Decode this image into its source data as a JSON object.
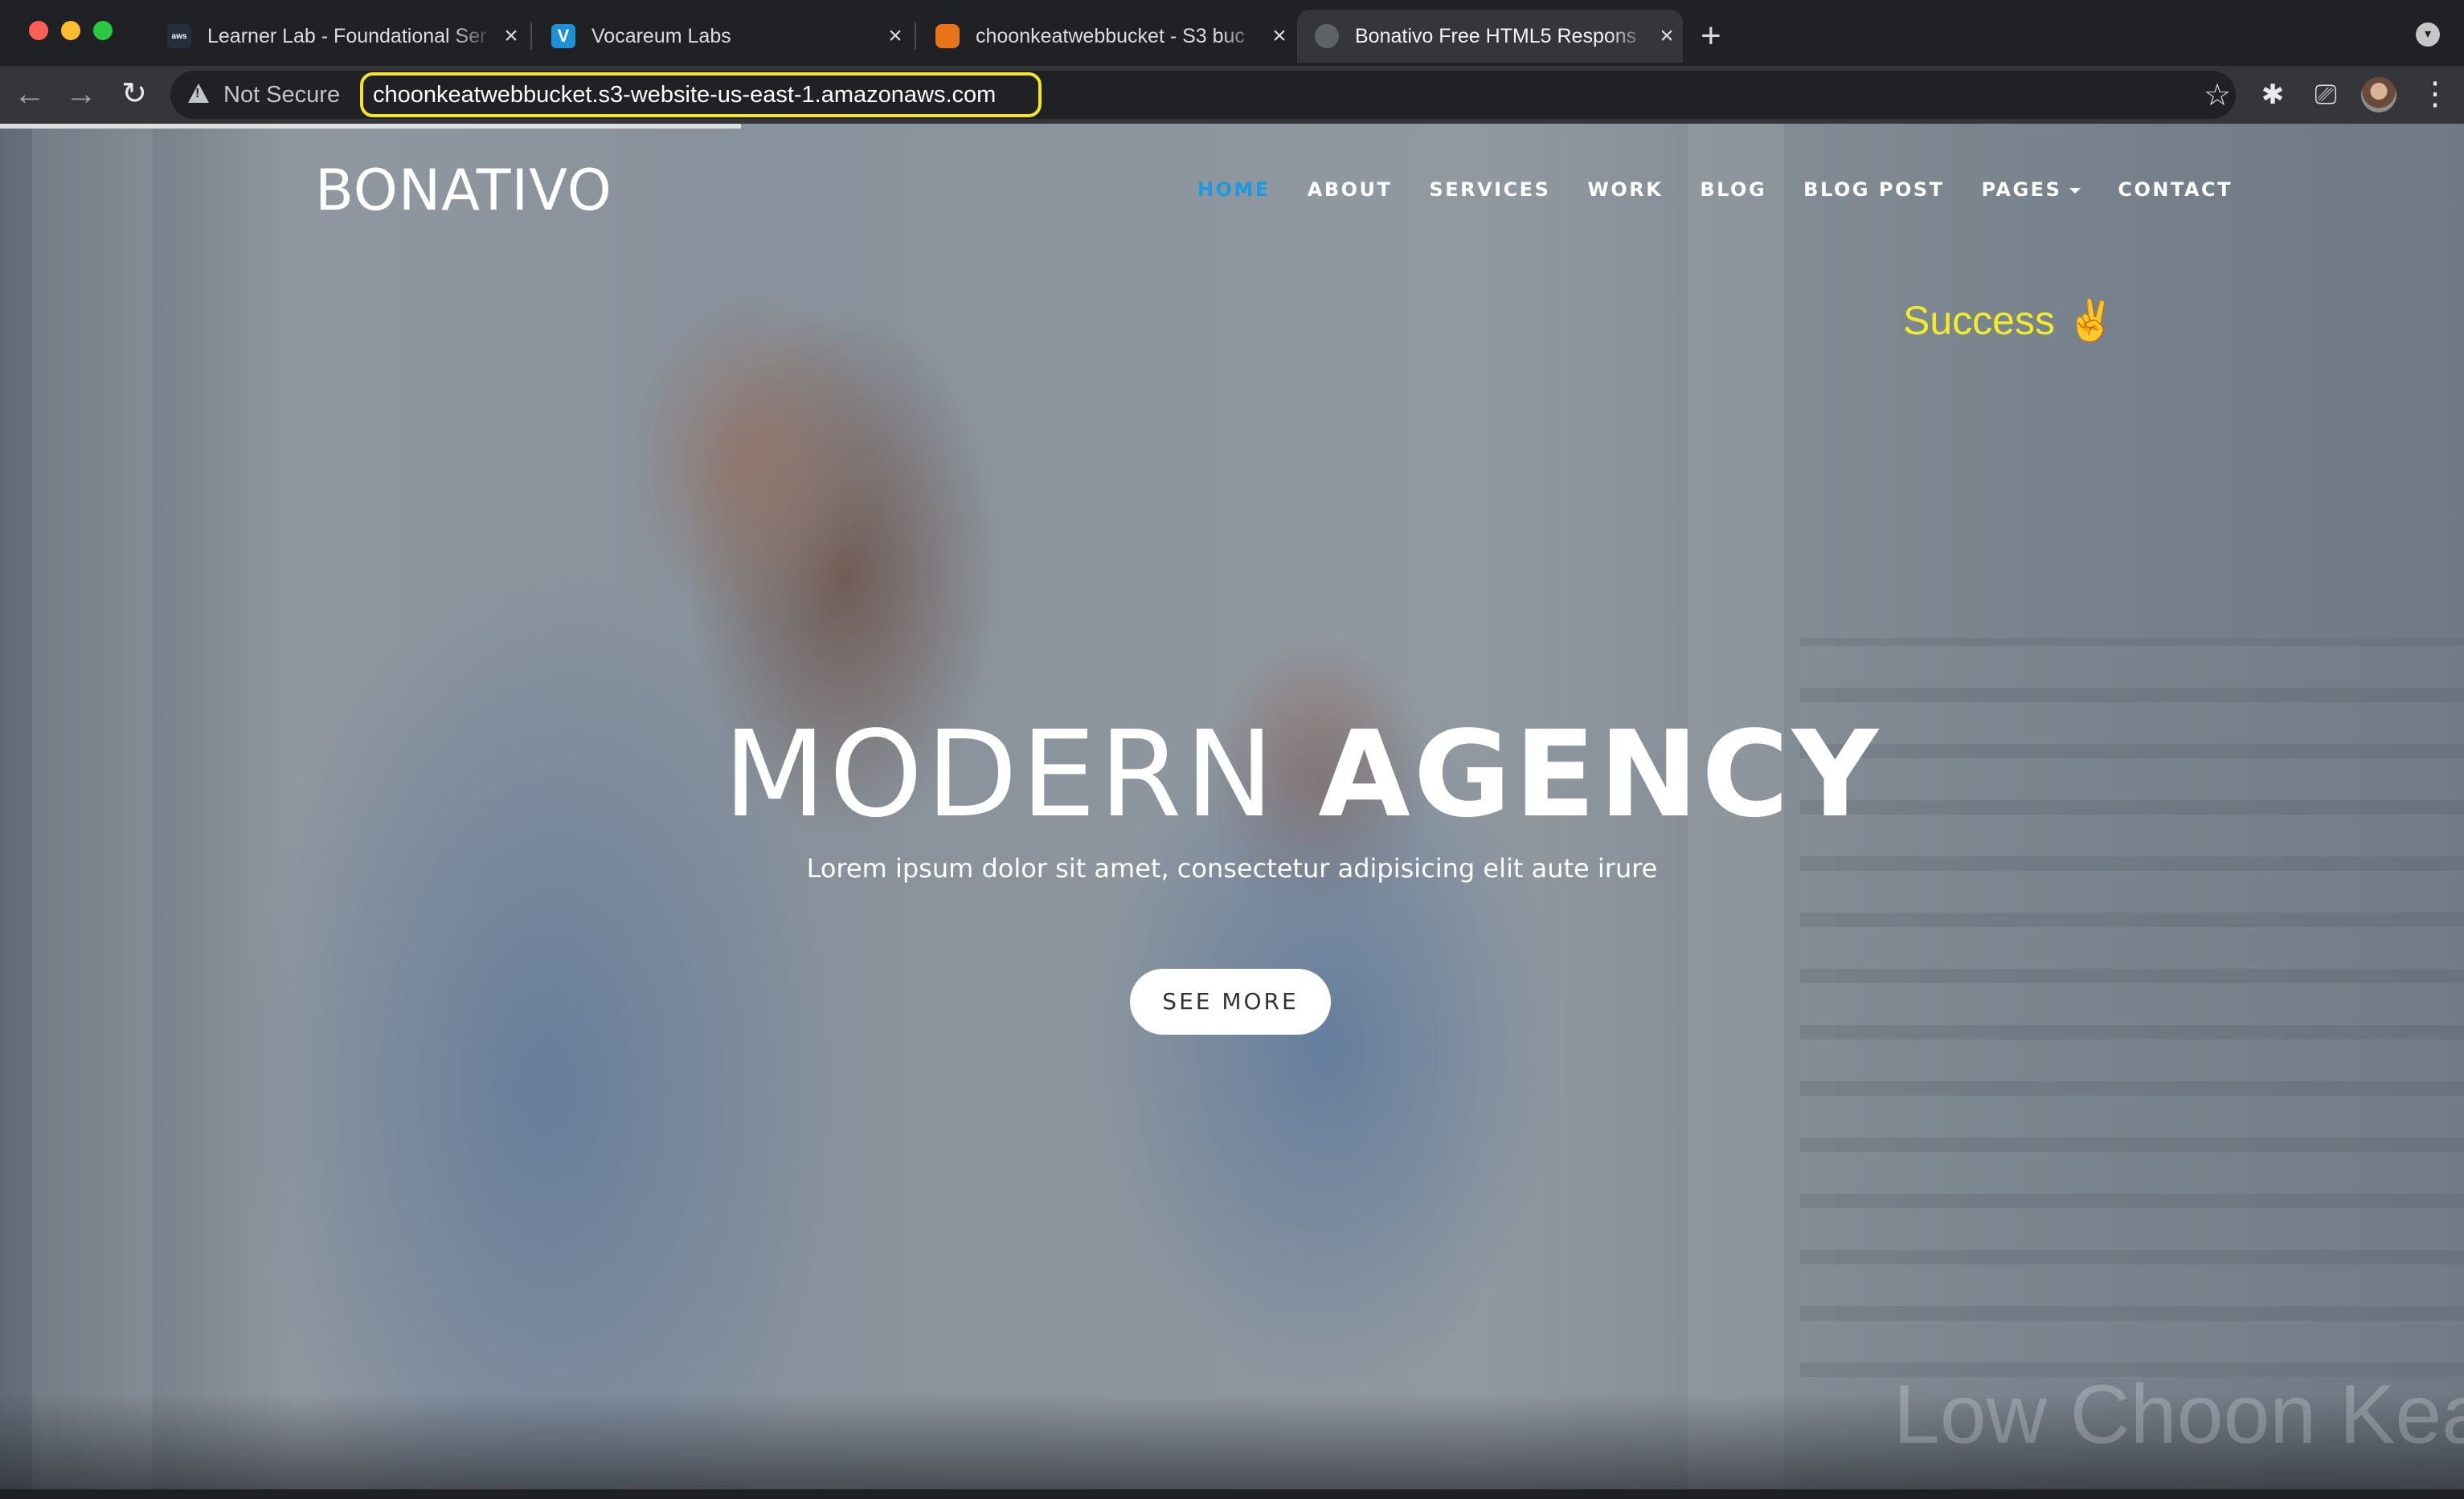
{
  "browser": {
    "tabs": [
      {
        "title": "Learner Lab - Foundational Ser",
        "favicon": "aws-icon",
        "active": false
      },
      {
        "title": "Vocareum Labs",
        "favicon": "vocareum-icon",
        "active": false
      },
      {
        "title": "choonkeatwebbucket - S3 buc",
        "favicon": "s3-bucket-icon",
        "active": false
      },
      {
        "title": "Bonativo Free HTML5 Respons",
        "favicon": "globe-icon",
        "active": true
      }
    ],
    "security_label": "Not Secure",
    "url": "choonkeatwebbucket.s3-website-us-east-1.amazonaws.com",
    "colors": {
      "url_highlight": "#f4e42a",
      "chrome_bg": "#202124",
      "toolbar_bg": "#35363a"
    }
  },
  "site": {
    "brand": "BONATIVO",
    "nav": [
      {
        "label": "HOME",
        "active": true
      },
      {
        "label": "ABOUT",
        "active": false
      },
      {
        "label": "SERVICES",
        "active": false
      },
      {
        "label": "WORK",
        "active": false
      },
      {
        "label": "BLOG",
        "active": false
      },
      {
        "label": "BLOG POST",
        "active": false
      },
      {
        "label": "PAGES",
        "active": false,
        "dropdown": true
      },
      {
        "label": "CONTACT",
        "active": false
      }
    ],
    "success_text": "Success ✌",
    "hero": {
      "title_light": "MODERN",
      "title_bold": "AGENCY",
      "subtitle": "Lorem ipsum dolor sit amet, consectetur adipisicing elit aute irure",
      "cta_label": "SEE MORE"
    },
    "watermark": "Low Choon Keat",
    "colors": {
      "nav_active": "#1a9be0",
      "success": "#f2eb28"
    }
  }
}
